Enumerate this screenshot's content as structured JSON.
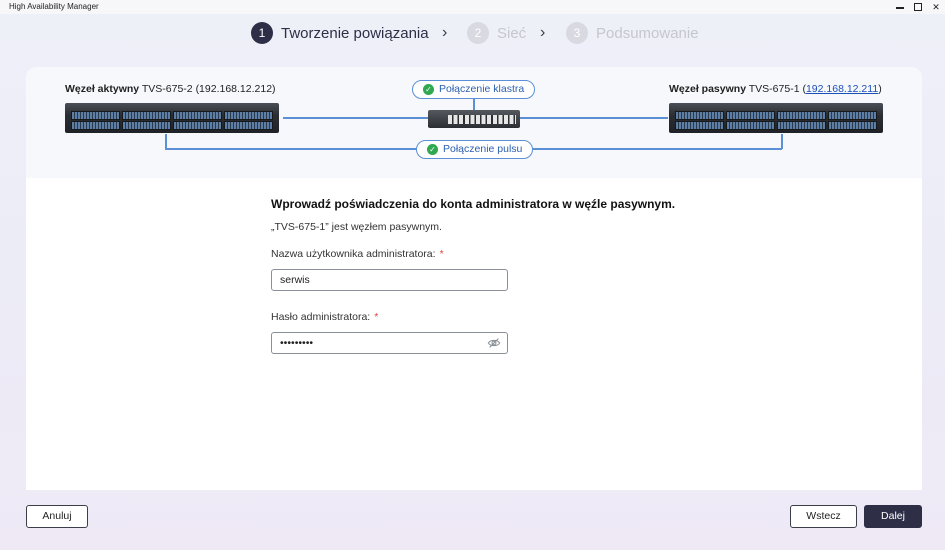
{
  "window": {
    "title": "High Availability Manager",
    "controls": {
      "minimize": "minimize-icon",
      "maximize": "maximize-icon",
      "close": "close-icon"
    }
  },
  "stepper": {
    "steps": [
      {
        "number": "1",
        "label": "Tworzenie powiązania",
        "active": true
      },
      {
        "number": "2",
        "label": "Sieć",
        "active": false
      },
      {
        "number": "3",
        "label": "Podsumowanie",
        "active": false
      }
    ],
    "separator_icon": "chevron-right-icon"
  },
  "topology": {
    "active_node": {
      "role_label": "Węzeł aktywny",
      "name": "TVS-675-2",
      "ip": "(192.168.12.212)"
    },
    "passive_node": {
      "role_label": "Węzeł pasywny",
      "name": "TVS-675-1",
      "ip_prefix": "(",
      "ip": "192.168.12.211",
      "ip_suffix": ")"
    },
    "cluster_connection": {
      "label": "Połączenie klastra",
      "icon": "check-circle-icon"
    },
    "heartbeat_connection": {
      "label": "Połączenie pulsu",
      "icon": "check-circle-icon"
    },
    "line_color": "#5b8fd6",
    "ok_color": "#2fa84f"
  },
  "form": {
    "title": "Wprowadź poświadczenia do konta administratora w węźle pasywnym.",
    "subtitle": "„TVS-675-1” jest węzłem pasywnym.",
    "username": {
      "label": "Nazwa użytkownika administratora:",
      "required_mark": "*",
      "value": "serwis"
    },
    "password": {
      "label": "Hasło administratora:",
      "required_mark": "*",
      "value": "•••••••••",
      "toggle_icon": "eye-slash-icon"
    }
  },
  "footer": {
    "cancel_label": "Anuluj",
    "back_label": "Wstecz",
    "next_label": "Dalej"
  },
  "colors": {
    "primary": "#2e2e46",
    "required": "#e0433a",
    "link": "#1b4fb8"
  }
}
